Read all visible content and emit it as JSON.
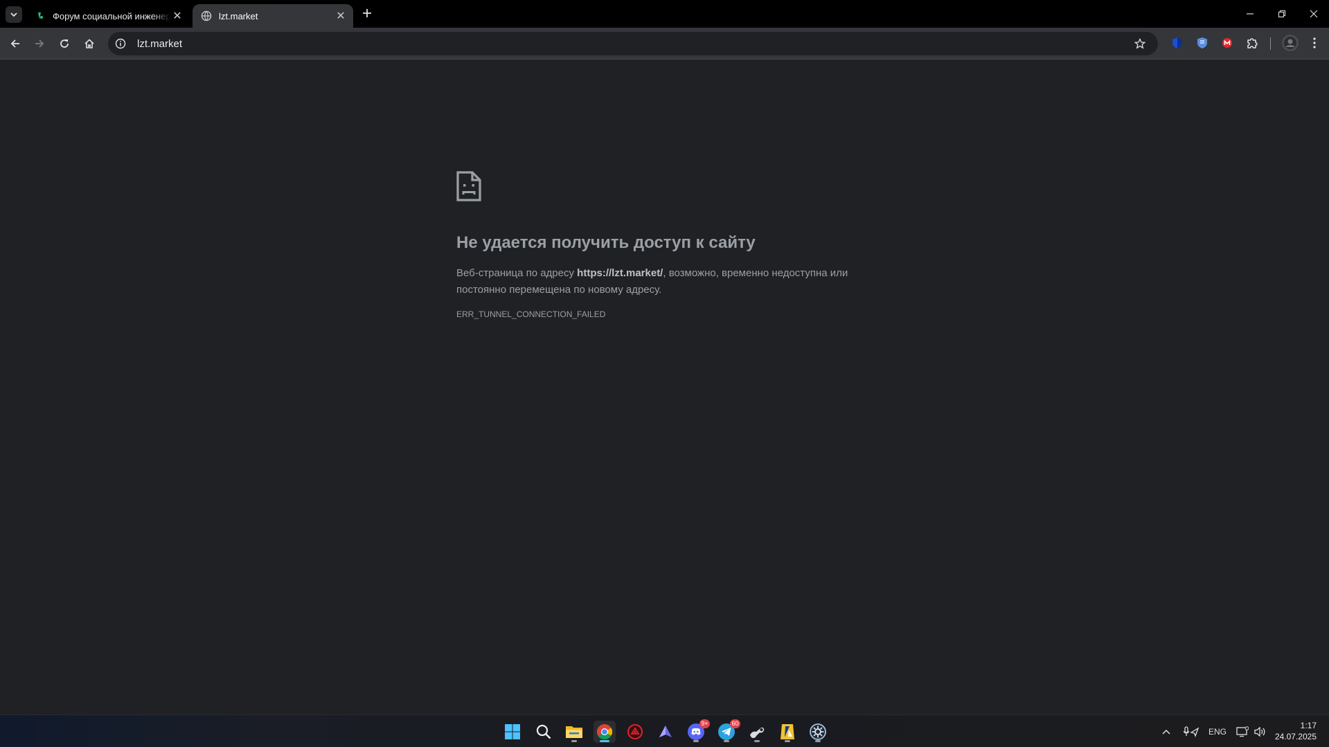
{
  "browser": {
    "tabs": [
      {
        "title": "Форум социальной инженерии",
        "active": false
      },
      {
        "title": "lzt.market",
        "active": true
      }
    ],
    "address_bar": {
      "url": "lzt.market"
    }
  },
  "error_page": {
    "title": "Не удается получить доступ к сайту",
    "desc_prefix": "Веб-страница по адресу ",
    "desc_url": "https://lzt.market/",
    "desc_suffix": ", возможно, временно недоступна или постоянно перемещена по новому адресу.",
    "code": "ERR_TUNNEL_CONNECTION_FAILED"
  },
  "taskbar": {
    "apps": [
      {
        "name": "start-button",
        "icon": "windows-icon"
      },
      {
        "name": "search-button",
        "icon": "search-icon"
      },
      {
        "name": "file-explorer",
        "icon": "folder-icon"
      },
      {
        "name": "chrome",
        "icon": "chrome-icon",
        "active": true
      },
      {
        "name": "app-red-circle",
        "icon": "red-circle-icon"
      },
      {
        "name": "app-triangle",
        "icon": "triangle-icon"
      },
      {
        "name": "discord",
        "icon": "discord-icon",
        "badge": "9+"
      },
      {
        "name": "telegram",
        "icon": "telegram-icon",
        "badge": "60"
      },
      {
        "name": "steam",
        "icon": "steam-icon"
      },
      {
        "name": "app-yellow",
        "icon": "yellow-app-icon"
      },
      {
        "name": "app-gear",
        "icon": "gear-app-icon"
      }
    ],
    "tray": {
      "language": "ENG",
      "time": "1:17",
      "date": "24.07.2025"
    }
  },
  "colors": {
    "page_bg": "#202124",
    "toolbar_bg": "#35363a",
    "text_muted": "#9aa0a6",
    "accent": "#4cc2ff"
  }
}
